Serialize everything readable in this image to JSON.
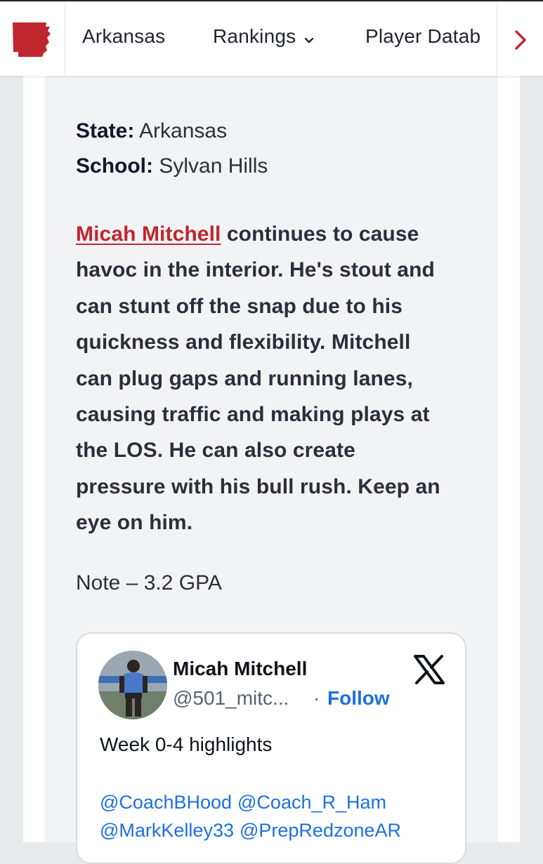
{
  "nav": {
    "items": [
      {
        "label": "Arkansas"
      },
      {
        "label": "Rankings"
      },
      {
        "label": "Player Datab"
      }
    ],
    "brand_color": "#c0262d"
  },
  "player_info": {
    "state_label": "State:",
    "state_value": "Arkansas",
    "school_label": "School:",
    "school_value": "Sylvan Hills"
  },
  "article": {
    "player_link": "Micah Mitchell",
    "lines": [
      " continues to cause",
      "havoc in the interior. He's stout and",
      "can stunt off the snap due to his",
      "quickness and flexibility. Mitchell",
      "can plug gaps and running lanes,",
      "causing traffic and making plays at",
      "the LOS. He can also create",
      "pressure with his bull rush. Keep an",
      "eye on him."
    ],
    "note": "Note – 3.2 GPA"
  },
  "tweet": {
    "name": "Micah Mitchell",
    "handle": "@501_mitc...",
    "dot": "·",
    "follow_label": "Follow",
    "text": "Week 0-4 highlights",
    "mentions": [
      "@CoachBHood",
      "@Coach_R_Ham",
      "@MarkKelley33",
      "@PrepRedzoneAR"
    ],
    "link_color": "#1d6fe0"
  }
}
